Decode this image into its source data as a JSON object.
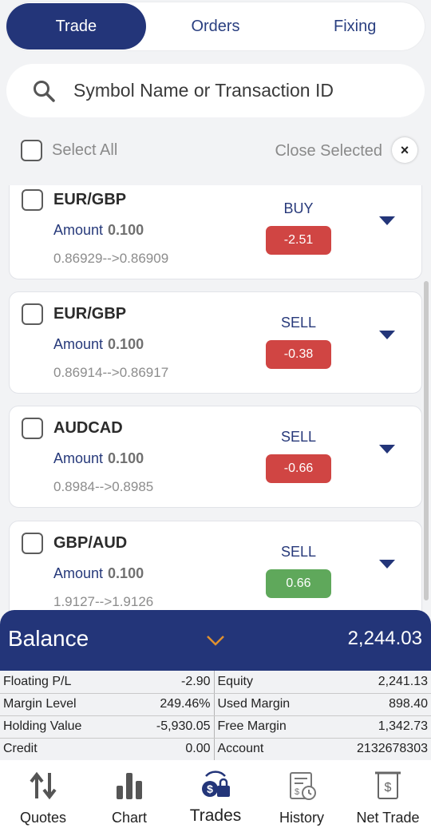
{
  "tabs": [
    {
      "label": "Trade",
      "active": true
    },
    {
      "label": "Orders",
      "active": false
    },
    {
      "label": "Fixing",
      "active": false
    }
  ],
  "search": {
    "placeholder": "Symbol Name or Transaction ID"
  },
  "select_all_label": "Select All",
  "close_selected_label": "Close Selected",
  "close_icon": "×",
  "amount_label": "Amount",
  "trades": [
    {
      "symbol": "EUR/GBP",
      "amount": "0.100",
      "prices": "0.86929-->0.86909",
      "side": "BUY",
      "pl": "-2.51",
      "pl_status": "negative"
    },
    {
      "symbol": "EUR/GBP",
      "amount": "0.100",
      "prices": "0.86914-->0.86917",
      "side": "SELL",
      "pl": "-0.38",
      "pl_status": "negative"
    },
    {
      "symbol": "AUDCAD",
      "amount": "0.100",
      "prices": "0.8984-->0.8985",
      "side": "SELL",
      "pl": "-0.66",
      "pl_status": "negative"
    },
    {
      "symbol": "GBP/AUD",
      "amount": "0.100",
      "prices": "1.9127-->1.9126",
      "side": "SELL",
      "pl": "0.66",
      "pl_status": "positive"
    }
  ],
  "balance": {
    "label": "Balance",
    "value": "2,244.03"
  },
  "account": [
    {
      "k1": "Floating P/L",
      "v1": "-2.90",
      "k2": "Equity",
      "v2": "2,241.13"
    },
    {
      "k1": "Margin Level",
      "v1": "249.46%",
      "k2": "Used Margin",
      "v2": "898.40"
    },
    {
      "k1": "Holding Value",
      "v1": "-5,930.05",
      "k2": "Free Margin",
      "v2": "1,342.73"
    },
    {
      "k1": "Credit",
      "v1": "0.00",
      "k2": "Account",
      "v2": "2132678303"
    }
  ],
  "nav": [
    {
      "label": "Quotes",
      "icon": "quotes-icon"
    },
    {
      "label": "Chart",
      "icon": "chart-icon"
    },
    {
      "label": "Trades",
      "icon": "trades-icon",
      "active": true
    },
    {
      "label": "History",
      "icon": "history-icon"
    },
    {
      "label": "Net Trade",
      "icon": "net-trade-icon"
    }
  ],
  "colors": {
    "primary": "#233579",
    "loss": "#d04543",
    "profit": "#5fa85b",
    "chevron": "#e0902e"
  }
}
